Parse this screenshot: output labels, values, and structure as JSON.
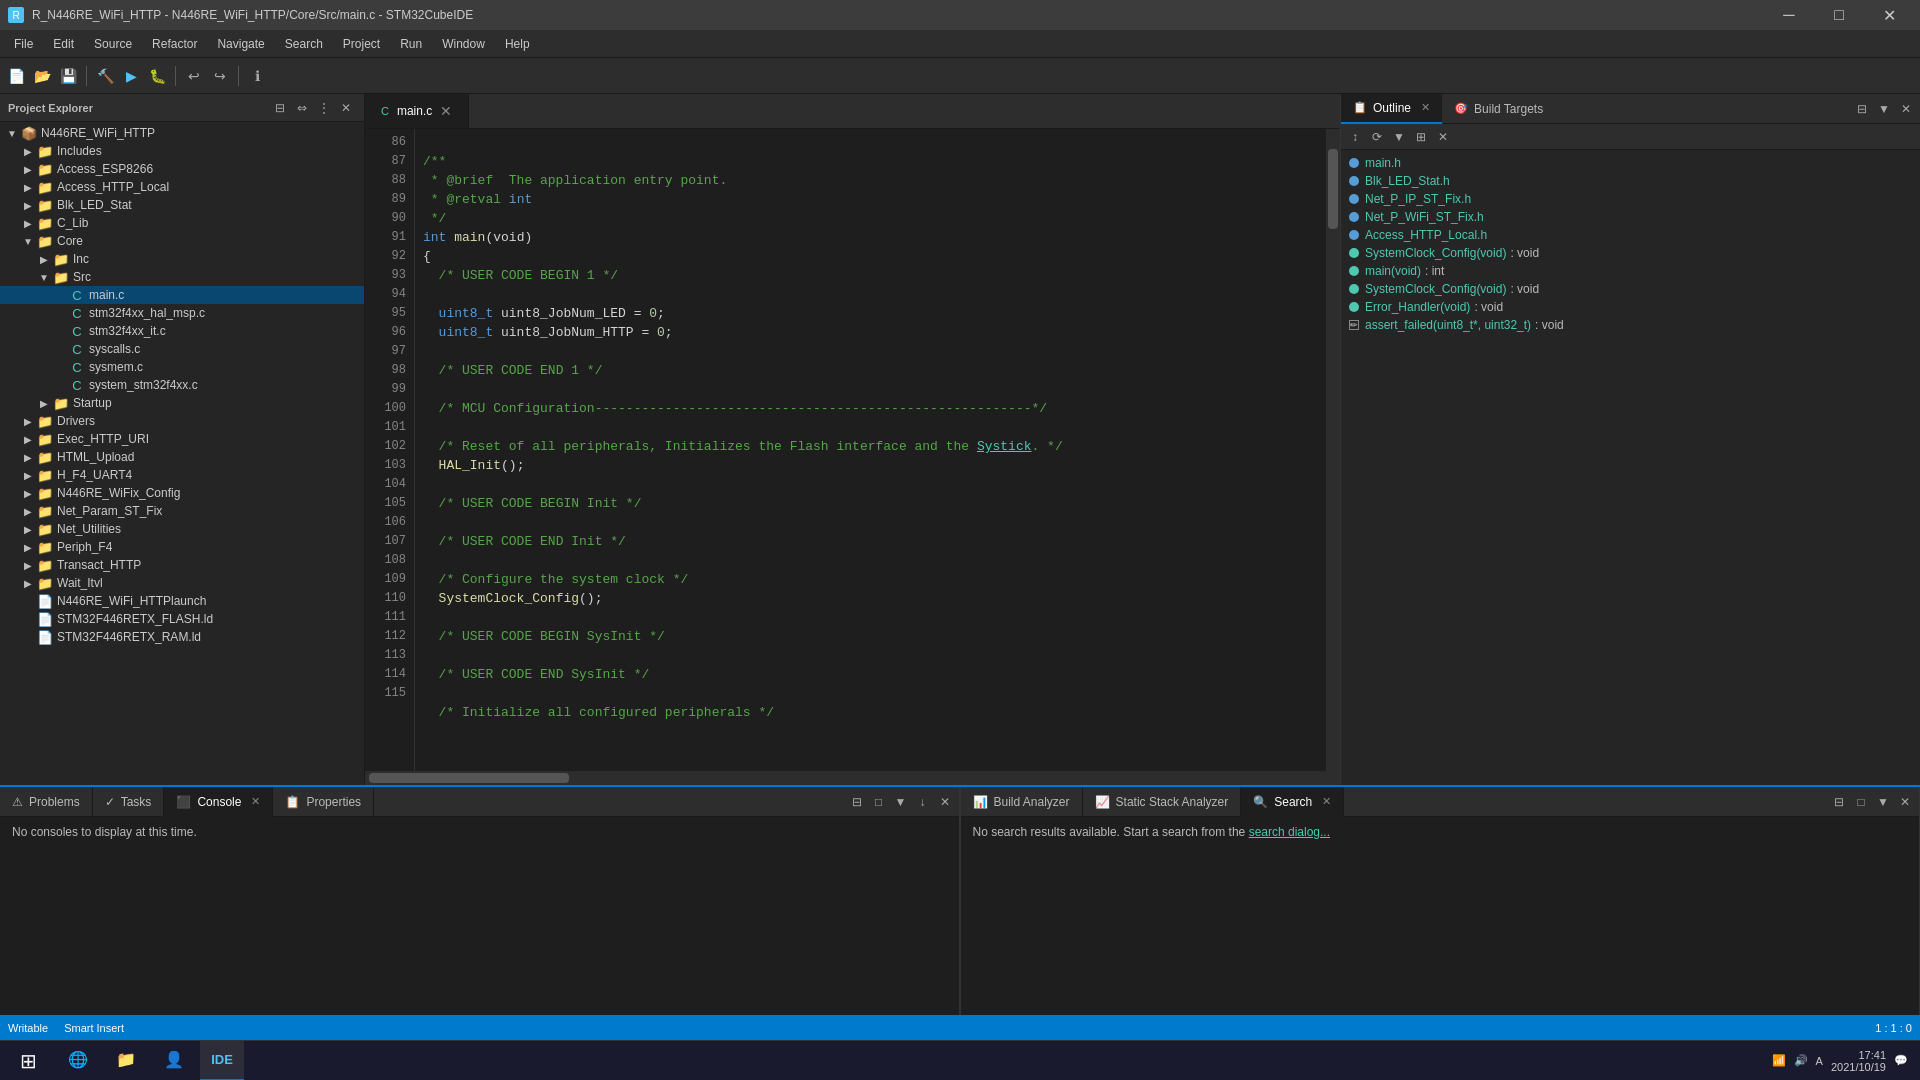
{
  "titleBar": {
    "title": "R_N446RE_WiFi_HTTP - N446RE_WiFi_HTTP/Core/Src/main.c - STM32CubeIDE",
    "icon": "IDE"
  },
  "menuBar": {
    "items": [
      "File",
      "Edit",
      "Source",
      "Refactor",
      "Navigate",
      "Search",
      "Project",
      "Run",
      "Window",
      "Help"
    ]
  },
  "editorTabs": [
    {
      "label": "main.c",
      "active": true
    }
  ],
  "sidebar": {
    "title": "Project Explorer",
    "root": "N446RE_WiFi_HTTP",
    "items": [
      {
        "label": "Includes",
        "type": "folder",
        "indent": 1,
        "expanded": false
      },
      {
        "label": "Access_ESP8266",
        "type": "folder",
        "indent": 1,
        "expanded": false
      },
      {
        "label": "Access_HTTP_Local",
        "type": "folder",
        "indent": 1,
        "expanded": false
      },
      {
        "label": "Blk_LED_Stat",
        "type": "folder",
        "indent": 1,
        "expanded": false
      },
      {
        "label": "C_Lib",
        "type": "folder",
        "indent": 1,
        "expanded": false
      },
      {
        "label": "Core",
        "type": "folder",
        "indent": 1,
        "expanded": true
      },
      {
        "label": "Inc",
        "type": "folder",
        "indent": 2,
        "expanded": false
      },
      {
        "label": "Src",
        "type": "folder",
        "indent": 2,
        "expanded": true
      },
      {
        "label": "main.c",
        "type": "file-c",
        "indent": 3,
        "selected": true
      },
      {
        "label": "stm32f4xx_hal_msp.c",
        "type": "file-c",
        "indent": 3
      },
      {
        "label": "stm32f4xx_it.c",
        "type": "file-c",
        "indent": 3
      },
      {
        "label": "syscalls.c",
        "type": "file-c",
        "indent": 3
      },
      {
        "label": "sysmem.c",
        "type": "file-c",
        "indent": 3
      },
      {
        "label": "system_stm32f4xx.c",
        "type": "file-c",
        "indent": 3
      },
      {
        "label": "Startup",
        "type": "folder",
        "indent": 2,
        "expanded": false
      },
      {
        "label": "Drivers",
        "type": "folder",
        "indent": 1,
        "expanded": false
      },
      {
        "label": "Exec_HTTP_URI",
        "type": "folder",
        "indent": 1,
        "expanded": false
      },
      {
        "label": "HTML_Upload",
        "type": "folder",
        "indent": 1,
        "expanded": false
      },
      {
        "label": "H_F4_UART4",
        "type": "folder",
        "indent": 1,
        "expanded": false
      },
      {
        "label": "N446RE_WiFix_Config",
        "type": "folder",
        "indent": 1,
        "expanded": false
      },
      {
        "label": "Net_Param_ST_Fix",
        "type": "folder",
        "indent": 1,
        "expanded": false
      },
      {
        "label": "Net_Utilities",
        "type": "folder",
        "indent": 1,
        "expanded": false
      },
      {
        "label": "Periph_F4",
        "type": "folder",
        "indent": 1,
        "expanded": false
      },
      {
        "label": "Transact_HTTP",
        "type": "folder",
        "indent": 1,
        "expanded": false
      },
      {
        "label": "Wait_Itvl",
        "type": "folder",
        "indent": 1,
        "expanded": false
      },
      {
        "label": "N446RE_WiFi_HTTPlaunch",
        "type": "file",
        "indent": 1
      },
      {
        "label": "STM32F446RETX_FLASH.ld",
        "type": "file",
        "indent": 1
      },
      {
        "label": "STM32F446RETX_RAM.ld",
        "type": "file",
        "indent": 1
      }
    ]
  },
  "code": {
    "startLine": 86,
    "lines": [
      {
        "num": 86,
        "text": ""
      },
      {
        "num": 87,
        "text": "/**"
      },
      {
        "num": 87,
        "text": " * @brief  The application entry point."
      },
      {
        "num": 88,
        "text": " * @retval int"
      },
      {
        "num": 89,
        "text": " */"
      },
      {
        "num": 90,
        "text": "int main(void)"
      },
      {
        "num": 91,
        "text": "{"
      },
      {
        "num": 92,
        "text": "  /* USER CODE BEGIN 1 */"
      },
      {
        "num": 93,
        "text": ""
      },
      {
        "num": 94,
        "text": "  uint8_t uint8_JobNum_LED = 0;"
      },
      {
        "num": 95,
        "text": "  uint8_t uint8_JobNum_HTTP = 0;"
      },
      {
        "num": 96,
        "text": ""
      },
      {
        "num": 97,
        "text": "  /* USER CODE END 1 */"
      },
      {
        "num": 98,
        "text": ""
      },
      {
        "num": 99,
        "text": "  /* MCU Configuration--------------------------------------------------------*/"
      },
      {
        "num": 100,
        "text": ""
      },
      {
        "num": 101,
        "text": "  /* Reset of all peripherals, Initializes the Flash interface and the Systick. */"
      },
      {
        "num": 102,
        "text": "  HAL_Init();"
      },
      {
        "num": 103,
        "text": ""
      },
      {
        "num": 104,
        "text": "  /* USER CODE BEGIN Init */"
      },
      {
        "num": 105,
        "text": ""
      },
      {
        "num": 106,
        "text": "  /* USER CODE END Init */"
      },
      {
        "num": 107,
        "text": ""
      },
      {
        "num": 108,
        "text": "  /* Configure the system clock */"
      },
      {
        "num": 109,
        "text": "  SystemClock_Config();"
      },
      {
        "num": 110,
        "text": ""
      },
      {
        "num": 111,
        "text": "  /* USER CODE BEGIN SysInit */"
      },
      {
        "num": 112,
        "text": ""
      },
      {
        "num": 113,
        "text": "  /* USER CODE END SysInit */"
      },
      {
        "num": 114,
        "text": ""
      },
      {
        "num": 115,
        "text": "  /* Initialize all configured peripherals */"
      }
    ]
  },
  "outlinePanel": {
    "tabs": [
      "Outline",
      "Build Targets"
    ],
    "activeTab": "Outline",
    "items": [
      {
        "name": "main.h",
        "type": "file",
        "color": "blue"
      },
      {
        "name": "Blk_LED_Stat.h",
        "type": "file",
        "color": "blue"
      },
      {
        "name": "Net_P_IP_ST_Fix.h",
        "type": "file",
        "color": "blue"
      },
      {
        "name": "Net_P_WiFi_ST_Fix.h",
        "type": "file",
        "color": "blue"
      },
      {
        "name": "Access_HTTP_Local.h",
        "type": "file",
        "color": "blue"
      },
      {
        "name": "SystemClock_Config(void)",
        "sig": ": void",
        "color": "green"
      },
      {
        "name": "main(void)",
        "sig": ": int",
        "color": "green"
      },
      {
        "name": "SystemClock_Config(void)",
        "sig": ": void",
        "color": "green"
      },
      {
        "name": "Error_Handler(void)",
        "sig": ": void",
        "color": "green"
      },
      {
        "name": "assert_failed(uint8_t*, uint32_t)",
        "sig": ": void",
        "color": "pencil"
      }
    ]
  },
  "bottomPanel": {
    "consoleTabs": [
      "Problems",
      "Tasks",
      "Console",
      "Properties"
    ],
    "activeConsoleTab": "Console",
    "consoleContent": "No consoles to display at this time.",
    "searchTabs": [
      "Build Analyzer",
      "Static Stack Analyzer",
      "Search"
    ],
    "activeSearchTab": "Search",
    "searchContent": "No search results available. Start a search from the",
    "searchLink": "search dialog...",
    "searchLinkEnd": ""
  },
  "statusBar": {
    "writable": "Writable",
    "insertMode": "Smart Insert",
    "position": "1 : 1 : 0"
  },
  "taskbar": {
    "apps": [
      {
        "icon": "⊞",
        "label": "",
        "type": "start"
      },
      {
        "icon": "🌐",
        "label": "Edge",
        "active": false
      },
      {
        "icon": "📁",
        "label": "Explorer",
        "active": false
      },
      {
        "icon": "👤",
        "label": "User",
        "active": false
      },
      {
        "icon": "IDE",
        "label": "STM32CubeIDE",
        "active": true
      }
    ],
    "tray": {
      "time": "17:41",
      "date": "2021/10/19",
      "language": "A"
    }
  }
}
